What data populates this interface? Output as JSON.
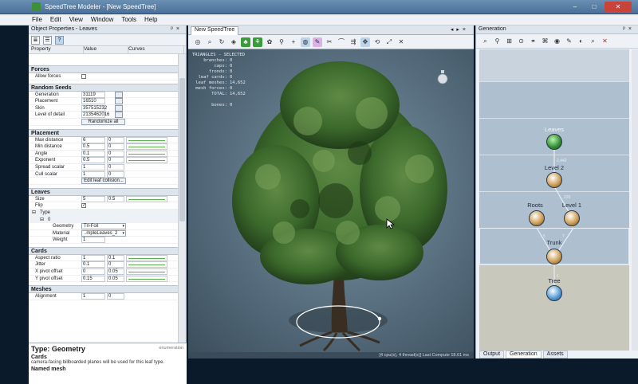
{
  "window": {
    "title": "SpeedTree Modeler - [New SpeedTree]"
  },
  "menu": [
    "File",
    "Edit",
    "View",
    "Window",
    "Tools",
    "Help"
  ],
  "left_panel": {
    "title": "Object Properties - Leaves",
    "columns": [
      "Property",
      "Value",
      "Curves"
    ],
    "sections": {
      "forces": {
        "title": "Forces",
        "rows": [
          {
            "label": "Allow forces"
          }
        ]
      },
      "random_seeds": {
        "title": "Random Seeds",
        "rows": [
          {
            "label": "Generation",
            "value": "31119"
          },
          {
            "label": "Placement",
            "value": "16510"
          },
          {
            "label": "Skin",
            "value": "357515232"
          },
          {
            "label": "Level of detail",
            "value": "2135462016"
          }
        ],
        "button": "Randomize all"
      },
      "placement": {
        "title": "Placement",
        "rows": [
          {
            "label": "Max distance",
            "value": "6",
            "value2": "0"
          },
          {
            "label": "Min distance",
            "value": "0.5",
            "value2": "0"
          },
          {
            "label": "Angle",
            "value": "0.1",
            "value2": "0"
          },
          {
            "label": "Exponent",
            "value": "0.5",
            "value2": "0"
          },
          {
            "label": "Spread scalar",
            "value": "1",
            "value2": "0"
          },
          {
            "label": "Cull scalar",
            "value": "1",
            "value2": "0"
          }
        ],
        "button": "Edit leaf collision..."
      },
      "leaves": {
        "title": "Leaves",
        "size": {
          "label": "Size",
          "value": "5",
          "value2": "0.5"
        },
        "flip": {
          "label": "Flip",
          "checked": "✓"
        },
        "type_label": "Type",
        "index_label": "0",
        "geometry": {
          "label": "Geometry",
          "value": "Tri-Foil"
        },
        "material": {
          "label": "Material",
          "value": "..mpleLeaves_2"
        },
        "weight": {
          "label": "Weight",
          "value": "1"
        }
      },
      "cards": {
        "title": "Cards",
        "rows": [
          {
            "label": "Aspect ratio",
            "value": "1",
            "value2": "0.1"
          },
          {
            "label": "Jitter",
            "value": "0.1",
            "value2": "0"
          },
          {
            "label": "X pivot offset",
            "value": "0",
            "value2": "0.05"
          },
          {
            "label": "Y pivot offset",
            "value": "0.15",
            "value2": "0.05"
          }
        ]
      },
      "meshes": {
        "title": "Meshes",
        "rows": [
          {
            "label": "Alignment",
            "value": "1",
            "value2": "0"
          }
        ]
      }
    },
    "type_box": {
      "title": "Type: Geometry",
      "meta": "enumeration",
      "cards_heading": "Cards",
      "cards_desc": "camera-facing billboarded planes will be used for this leaf type.",
      "mesh_heading": "Named mesh"
    }
  },
  "viewport": {
    "tab": "New SpeedTree",
    "stats_header": "TRIANGLES - SELECTED",
    "stats": [
      {
        "k": "branches:",
        "v": "0"
      },
      {
        "k": "caps:",
        "v": "0"
      },
      {
        "k": "fronds:",
        "v": "0"
      },
      {
        "k": "leaf cards:",
        "v": "0"
      },
      {
        "k": "leaf meshes:",
        "v": "14,652"
      },
      {
        "k": "mesh forces:",
        "v": "0"
      },
      {
        "k": "TOTAL:",
        "v": "14,652"
      },
      {
        "k": "",
        "v": ""
      },
      {
        "k": "bones:",
        "v": "0"
      }
    ],
    "status": "[4 cpu(s), 4 thread(s)]   Last Compute 18.61 ms"
  },
  "right_panel": {
    "title": "Generation",
    "nodes": {
      "leaves": "Leaves",
      "level2": "Level 2",
      "roots": "Roots",
      "level1": "Level 1",
      "trunk": "Trunk",
      "tree": "Tree"
    },
    "edge_labels": {
      "leaves_level2": "2,442",
      "level2_level1": "220",
      "roots_trunk": "5",
      "level1_trunk": "7",
      "trunk_tree": "1"
    },
    "tabs": [
      "Output",
      "Generation",
      "Assets"
    ]
  },
  "colors": {
    "title_bar": "#4a7099",
    "viewport_bg": "#5d7485",
    "leaf_green": "#2f8c2f",
    "graph_band": "#aebfd0"
  }
}
